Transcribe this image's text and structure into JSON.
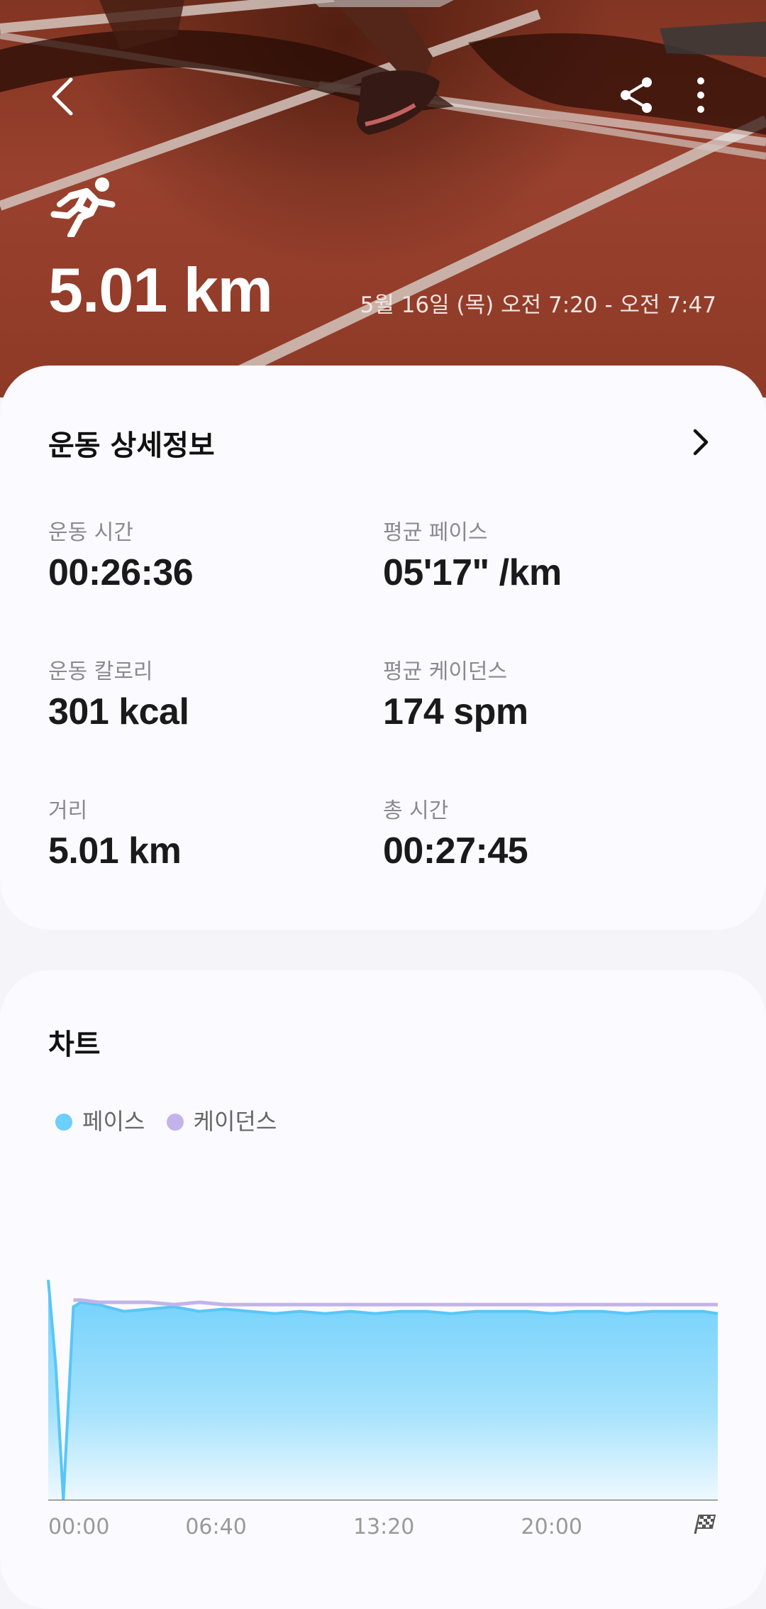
{
  "header": {
    "distance": "5.01 km",
    "date_range": "5월 16일 (목) 오전 7:20 - 오전 7:47"
  },
  "details": {
    "title": "운동 상세정보",
    "stats": [
      {
        "label": "운동 시간",
        "value": "00:26:36"
      },
      {
        "label": "평균 페이스",
        "value": "05'17\" /km"
      },
      {
        "label": "운동 칼로리",
        "value": "301 kcal"
      },
      {
        "label": "평균 케이던스",
        "value": "174 spm"
      },
      {
        "label": "거리",
        "value": "5.01 km"
      },
      {
        "label": "총 시간",
        "value": "00:27:45"
      }
    ]
  },
  "chart": {
    "title": "차트",
    "legend": [
      {
        "name": "페이스",
        "color": "#6dcffb"
      },
      {
        "name": "케이던스",
        "color": "#c3b3ea"
      }
    ]
  },
  "chart_data": {
    "type": "area",
    "x_tick_labels": [
      "00:00",
      "06:40",
      "13:20",
      "20:00"
    ],
    "x_minutes": [
      0,
      0.3,
      0.6,
      1.0,
      1.3,
      2.0,
      3.0,
      4.0,
      5.0,
      6.0,
      7.0,
      8.0,
      9.0,
      10.0,
      11.0,
      12.0,
      13.0,
      14.0,
      15.0,
      16.0,
      17.0,
      18.0,
      19.0,
      20.0,
      21.0,
      22.0,
      23.0,
      24.0,
      25.0,
      26.0,
      26.6
    ],
    "series": [
      {
        "name": "페이스",
        "values": [
          0.98,
          0.6,
          0.0,
          0.86,
          0.88,
          0.87,
          0.84,
          0.85,
          0.86,
          0.84,
          0.85,
          0.84,
          0.83,
          0.84,
          0.83,
          0.84,
          0.83,
          0.84,
          0.84,
          0.83,
          0.84,
          0.84,
          0.84,
          0.83,
          0.84,
          0.84,
          0.83,
          0.84,
          0.84,
          0.84,
          0.83
        ]
      },
      {
        "name": "케이던스",
        "values": [
          0.0,
          0.0,
          0.0,
          0.89,
          0.89,
          0.88,
          0.88,
          0.88,
          0.87,
          0.88,
          0.87,
          0.87,
          0.87,
          0.87,
          0.87,
          0.87,
          0.87,
          0.87,
          0.87,
          0.87,
          0.87,
          0.87,
          0.87,
          0.87,
          0.87,
          0.87,
          0.87,
          0.87,
          0.87,
          0.87,
          0.87
        ]
      }
    ],
    "xlim": [
      0,
      26.6
    ],
    "ylim": [
      0,
      1
    ],
    "legend_position": "top-left",
    "grid": false
  }
}
